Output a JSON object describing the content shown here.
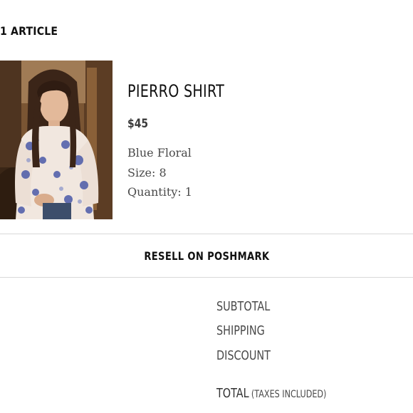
{
  "cart": {
    "article_count": "1 ARTICLE"
  },
  "item": {
    "image_icon": "product-photo",
    "name": "PIERRO SHIRT",
    "price": "$45",
    "color": "Blue Floral",
    "size": "Size: 8",
    "quantity": "Quantity: 1"
  },
  "actions": {
    "resell_label": "RESELL ON POSHMARK"
  },
  "summary": {
    "subtotal_label": "SUBTOTAL",
    "shipping_label": "SHIPPING",
    "discount_label": "DISCOUNT",
    "total_label": "TOTAL",
    "total_note": "(TAXES INCLUDED)"
  },
  "colors": {
    "text_primary": "#111111",
    "text_secondary": "#4a4a4a",
    "divider": "#d8d8d8",
    "background": "#ffffff"
  }
}
